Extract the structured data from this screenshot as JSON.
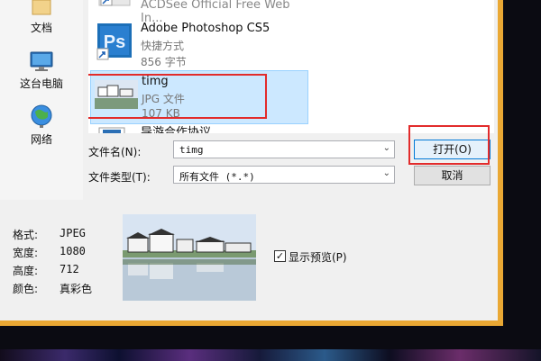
{
  "places": [
    {
      "label": "文档",
      "icon": "documents-icon"
    },
    {
      "label": "这台电脑",
      "icon": "this-pc-icon"
    },
    {
      "label": "网络",
      "icon": "network-icon"
    }
  ],
  "files": [
    {
      "name": "ACDSee Official Free Web In...",
      "type": "",
      "size": ""
    },
    {
      "name": "Adobe Photoshop CS5",
      "type": "快捷方式",
      "size": "856 字节",
      "icon_text": "Ps"
    },
    {
      "name": "timg",
      "type": "JPG 文件",
      "size": "107 KB"
    },
    {
      "name": "导游合作协议",
      "type": "",
      "size": ""
    }
  ],
  "form": {
    "filename_label": "文件名(N):",
    "filename_value": "timg",
    "filetype_label": "文件类型(T):",
    "filetype_value": "所有文件 (*.*)",
    "open_label": "打开(O)",
    "cancel_label": "取消"
  },
  "properties": [
    {
      "label": "格式:",
      "value": "JPEG"
    },
    {
      "label": "宽度:",
      "value": "1080"
    },
    {
      "label": "高度:",
      "value": "712"
    },
    {
      "label": "颜色:",
      "value": "真彩色"
    }
  ],
  "preview_check": {
    "label": "显示预览(P)",
    "checked": true
  },
  "colors": {
    "frame": "#eaa834",
    "selection": "#cce8ff",
    "highlight": "#e22b2b",
    "ps_blue": "#1c6fb8"
  }
}
